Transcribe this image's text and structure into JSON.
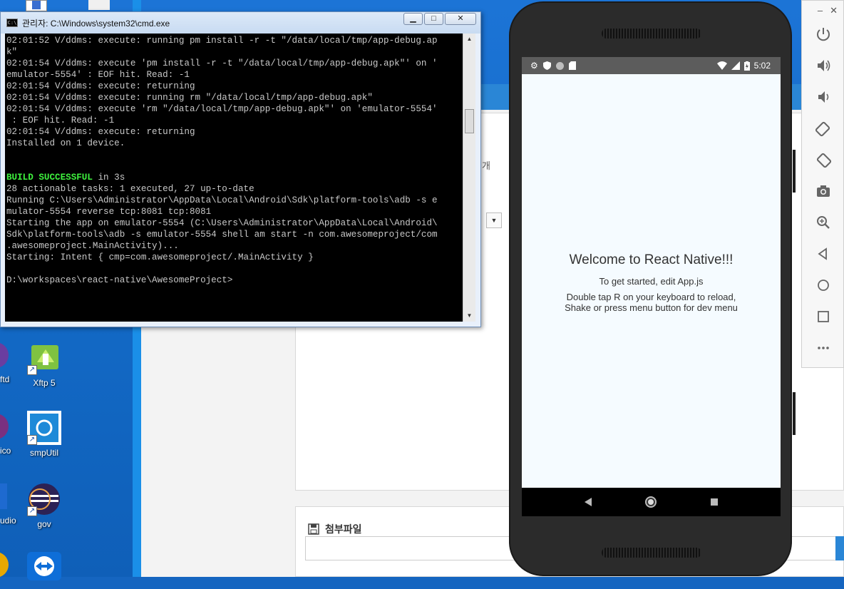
{
  "cmd": {
    "title": "관리자: C:\\Windows\\system32\\cmd.exe",
    "buttons": {
      "minimize": "▁",
      "maximize": "□",
      "close": "✕"
    },
    "lines": [
      "02:01:52 V/ddms: execute: running pm install -r -t \"/data/local/tmp/app-debug.ap",
      "k\"",
      "02:01:54 V/ddms: execute 'pm install -r -t \"/data/local/tmp/app-debug.apk\"' on '",
      "emulator-5554' : EOF hit. Read: -1",
      "02:01:54 V/ddms: execute: returning",
      "02:01:54 V/ddms: execute: running rm \"/data/local/tmp/app-debug.apk\"",
      "02:01:54 V/ddms: execute 'rm \"/data/local/tmp/app-debug.apk\"' on 'emulator-5554'",
      " : EOF hit. Read: -1",
      "02:01:54 V/ddms: execute: returning",
      "Installed on 1 device.",
      "",
      "",
      "BUILD SUCCESSFUL|| in 3s",
      "28 actionable tasks: 1 executed, 27 up-to-date",
      "Running C:\\Users\\Administrator\\AppData\\Local\\Android\\Sdk\\platform-tools\\adb -s e",
      "mulator-5554 reverse tcp:8081 tcp:8081",
      "Starting the app on emulator-5554 (C:\\Users\\Administrator\\AppData\\Local\\Android\\",
      "Sdk\\platform-tools\\adb -s emulator-5554 shell am start -n com.awesomeproject/com",
      ".awesomeproject.MainActivity)...",
      "Starting: Intent { cmp=com.awesomeproject/.MainActivity }",
      "",
      "D:\\workspaces\\react-native\\AwesomeProject>"
    ]
  },
  "desktop_icons": [
    {
      "label": "Xftp 5",
      "icon": "xftp-icon"
    },
    {
      "label": "smpUtil",
      "icon": "smputil-icon"
    },
    {
      "label": "gov",
      "icon": "eclipse-icon"
    },
    {
      "label": "",
      "icon": "teamviewer-icon"
    }
  ],
  "partial_icon_labels": [
    "ftd",
    "ico",
    "udio"
  ],
  "browser": {
    "partial_text": "개",
    "attachment_label": "첨부파일"
  },
  "phone": {
    "status_time": "5:02",
    "welcome": "Welcome to React Native!!!",
    "instructions": "To get started, edit App.js",
    "reload_line1": "Double tap R on your keyboard to reload,",
    "reload_line2": "Shake or press menu button for dev menu",
    "background_color": "#F5FCFF"
  },
  "emulator_toolbar": {
    "minimize": "–",
    "close": "✕"
  }
}
